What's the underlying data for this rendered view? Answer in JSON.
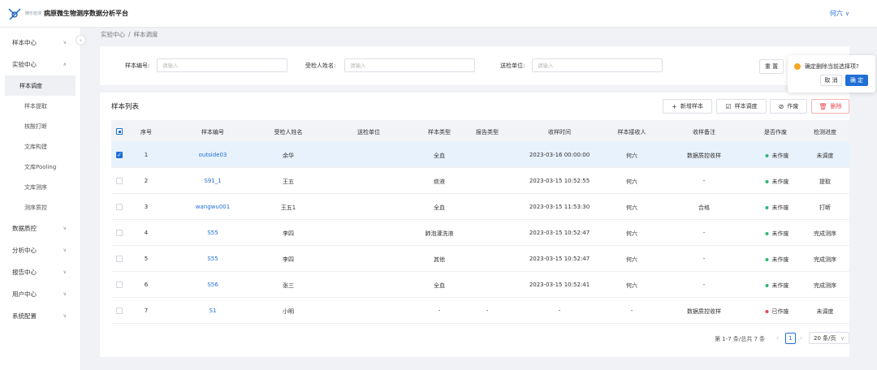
{
  "app": {
    "logo_sub": "微乐检测",
    "title": "病原微生物测序数据分析平台",
    "user": "何六"
  },
  "sidebar": {
    "groups": [
      {
        "label": "样本中心"
      },
      {
        "label": "实验中心"
      },
      {
        "label": "数据质控"
      },
      {
        "label": "分析中心"
      },
      {
        "label": "报告中心"
      },
      {
        "label": "用户中心"
      },
      {
        "label": "系统配置"
      }
    ],
    "subitems": [
      {
        "label": "样本调度"
      },
      {
        "label": "样本提取"
      },
      {
        "label": "核酸打断"
      },
      {
        "label": "文库构建"
      },
      {
        "label": "文库Pooling"
      },
      {
        "label": "文库测序"
      },
      {
        "label": "测序质控"
      }
    ]
  },
  "breadcrumb": {
    "root": "实验中心",
    "separator": "/",
    "current": "样本调度"
  },
  "filters": {
    "sample_no_label": "样本编号:",
    "sample_no_placeholder": "请输入",
    "patient_label": "受检人姓名:",
    "patient_placeholder": "请输入",
    "unit_label": "送检单位:",
    "unit_placeholder": "请输入",
    "reset": "重 置"
  },
  "popover": {
    "message": "确定删除当前选择项?",
    "cancel": "取 消",
    "confirm": "确 定"
  },
  "list": {
    "title": "样本列表",
    "buttons": {
      "add": "新增样本",
      "dispatch": "样本调度",
      "void": "作废",
      "delete": "删除"
    },
    "columns": [
      "序号",
      "样本编号",
      "受检人姓名",
      "送检单位",
      "样本类型",
      "报告类型",
      "收样时间",
      "样本接收人",
      "收样备注",
      "是否作废",
      "检测进度"
    ],
    "rows": [
      {
        "no": "1",
        "sample": "outside03",
        "name": "余华",
        "unit": "",
        "type": "全血",
        "report": "",
        "time": "2023-03-16 00:00:00",
        "receiver": "何六",
        "note": "数据质控收样",
        "void": "未作废",
        "progress": "未调度"
      },
      {
        "no": "2",
        "sample": "S91_1",
        "name": "王五",
        "unit": "",
        "type": "痰液",
        "report": "",
        "time": "2023-03-15 10:52:55",
        "receiver": "何六",
        "note": "-",
        "void": "未作废",
        "progress": "提取"
      },
      {
        "no": "3",
        "sample": "wangwu001",
        "name": "王五1",
        "unit": "",
        "type": "全血",
        "report": "",
        "time": "2023-03-15 11:53:30",
        "receiver": "何六",
        "note": "合格",
        "void": "未作废",
        "progress": "打断"
      },
      {
        "no": "4",
        "sample": "S55",
        "name": "李四",
        "unit": "",
        "type": "肺泡灌洗液",
        "report": "",
        "time": "2023-03-15 10:52:47",
        "receiver": "何六",
        "note": "-",
        "void": "未作废",
        "progress": "完成测序"
      },
      {
        "no": "5",
        "sample": "S55",
        "name": "李四",
        "unit": "",
        "type": "其他",
        "report": "",
        "time": "2023-03-15 10:52:47",
        "receiver": "何六",
        "note": "-",
        "void": "未作废",
        "progress": "完成测序"
      },
      {
        "no": "6",
        "sample": "S56",
        "name": "张三",
        "unit": "",
        "type": "全血",
        "report": "",
        "time": "2023-03-15 10:52:41",
        "receiver": "何六",
        "note": "-",
        "void": "未作废",
        "progress": "完成测序"
      },
      {
        "no": "7",
        "sample": "S1",
        "name": "小明",
        "unit": "",
        "type": "-",
        "report": "-",
        "time": "-",
        "receiver": "-",
        "note": "数据质控收样",
        "void": "已作废",
        "progress": "未调度"
      }
    ]
  },
  "pagination": {
    "summary": "第 1-7 条/总共 7 条",
    "current": "1",
    "page_size": "20 条/页"
  },
  "colors": {
    "primary": "#1f6fd6",
    "ok": "#2bb673",
    "danger": "#e5484d",
    "warning": "#f5a623"
  }
}
